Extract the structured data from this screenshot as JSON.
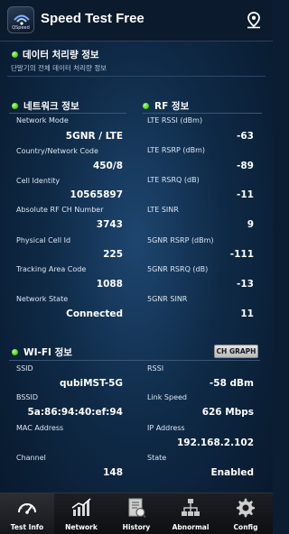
{
  "header": {
    "app_title": "Speed Test Free",
    "logo_text": "QSpeed",
    "location_icon": "location-pin-icon"
  },
  "data_section": {
    "title": "데이터 처리량 정보",
    "description": "단말기의 전체 데이터 처리량 정보"
  },
  "network_section": {
    "title": "네트워크 정보",
    "rows": [
      {
        "label": "Network Mode",
        "value": "5GNR / LTE"
      },
      {
        "label": "Country/Network Code",
        "value": "450/8"
      },
      {
        "label": "Cell Identity",
        "value": "10565897"
      },
      {
        "label": "Absolute RF CH Number",
        "value": "3743"
      },
      {
        "label": "Physical Cell Id",
        "value": "225"
      },
      {
        "label": "Tracking Area Code",
        "value": "1088"
      },
      {
        "label": "Network State",
        "value": "Connected"
      }
    ]
  },
  "rf_section": {
    "title": "RF 정보",
    "rows": [
      {
        "label": "LTE RSSI (dBm)",
        "value": "-63"
      },
      {
        "label": "LTE RSRP (dBm)",
        "value": "-89"
      },
      {
        "label": "LTE RSRQ (dB)",
        "value": "-11"
      },
      {
        "label": "LTE SINR",
        "value": "9"
      },
      {
        "label": "5GNR RSRP (dBm)",
        "value": "-111"
      },
      {
        "label": "5GNR RSRQ (dB)",
        "value": "-13"
      },
      {
        "label": "5GNR SINR",
        "value": "11"
      }
    ]
  },
  "wifi_section": {
    "title": "WI-FI 정보",
    "graph_button": "CH GRAPH",
    "left_rows": [
      {
        "label": "SSID",
        "value": "qubiMST-5G"
      },
      {
        "label": "BSSID",
        "value": "5a:86:94:40:ef:94"
      },
      {
        "label": "MAC Address",
        "value": ""
      },
      {
        "label": "Channel",
        "value": "148"
      }
    ],
    "right_rows": [
      {
        "label": "RSSI",
        "value": "-58 dBm"
      },
      {
        "label": "Link Speed",
        "value": "626 Mbps"
      },
      {
        "label": "IP Address",
        "value": "192.168.2.102"
      },
      {
        "label": "State",
        "value": "Enabled"
      }
    ]
  },
  "bottom_nav": {
    "items": [
      {
        "label": "Test Info",
        "icon": "speedometer-icon",
        "active": true
      },
      {
        "label": "Network",
        "icon": "bar-chart-icon",
        "active": false
      },
      {
        "label": "History",
        "icon": "history-document-icon",
        "active": false
      },
      {
        "label": "Abnormal",
        "icon": "network-topology-icon",
        "active": false
      },
      {
        "label": "Config",
        "icon": "gear-icon",
        "active": false
      }
    ]
  },
  "colors": {
    "accent_green": "#4fd22a",
    "background": "#0f2a47",
    "header": "#0c1a2e"
  }
}
